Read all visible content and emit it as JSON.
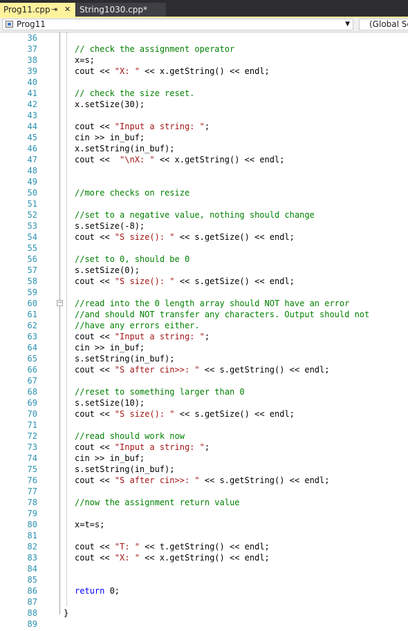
{
  "tabs": [
    {
      "label": "Prog11.cpp",
      "pin_glyph": "⇥",
      "close_glyph": "✕",
      "active": true
    },
    {
      "label": "String1030.cpp*",
      "active": false
    }
  ],
  "navbar": {
    "project": "Prog11",
    "scope": "(Global Sco"
  },
  "editor": {
    "lines": [
      {
        "n": "36",
        "code": ""
      },
      {
        "n": "37",
        "code": "// check the assignment operator"
      },
      {
        "n": "38",
        "code": "x=s;"
      },
      {
        "n": "39",
        "code": "cout << \"X: \" << x.getString() << endl;"
      },
      {
        "n": "40",
        "code": ""
      },
      {
        "n": "41",
        "code": "// check the size reset."
      },
      {
        "n": "42",
        "code": "x.setSize(30);"
      },
      {
        "n": "43",
        "code": ""
      },
      {
        "n": "44",
        "code": "cout << \"Input a string: \";"
      },
      {
        "n": "45",
        "code": "cin >> in_buf;"
      },
      {
        "n": "46",
        "code": "x.setString(in_buf);"
      },
      {
        "n": "47",
        "code": "cout <<  \"\\nX: \" << x.getString() << endl;"
      },
      {
        "n": "48",
        "code": ""
      },
      {
        "n": "49",
        "code": ""
      },
      {
        "n": "50",
        "code": "//more checks on resize"
      },
      {
        "n": "51",
        "code": ""
      },
      {
        "n": "52",
        "code": "//set to a negative value, nothing should change"
      },
      {
        "n": "53",
        "code": "s.setSize(-8);"
      },
      {
        "n": "54",
        "code": "cout << \"S size(): \" << s.getSize() << endl;"
      },
      {
        "n": "55",
        "code": ""
      },
      {
        "n": "56",
        "code": "//set to 0, should be 0"
      },
      {
        "n": "57",
        "code": "s.setSize(0);"
      },
      {
        "n": "58",
        "code": "cout << \"S size(): \" << s.getSize() << endl;"
      },
      {
        "n": "59",
        "code": ""
      },
      {
        "n": "60",
        "code": "//read into the 0 length array should NOT have an error"
      },
      {
        "n": "61",
        "code": "//and should NOT transfer any characters. Output should not"
      },
      {
        "n": "62",
        "code": "//have any errors either."
      },
      {
        "n": "63",
        "code": "cout << \"Input a string: \";"
      },
      {
        "n": "64",
        "code": "cin >> in_buf;"
      },
      {
        "n": "65",
        "code": "s.setString(in_buf);"
      },
      {
        "n": "66",
        "code": "cout << \"S after cin>>: \" << s.getString() << endl;"
      },
      {
        "n": "67",
        "code": ""
      },
      {
        "n": "68",
        "code": "//reset to something larger than 0"
      },
      {
        "n": "69",
        "code": "s.setSize(10);"
      },
      {
        "n": "70",
        "code": "cout << \"S size(): \" << s.getSize() << endl;"
      },
      {
        "n": "71",
        "code": ""
      },
      {
        "n": "72",
        "code": "//read should work now"
      },
      {
        "n": "73",
        "code": "cout << \"Input a string: \";"
      },
      {
        "n": "74",
        "code": "cin >> in_buf;"
      },
      {
        "n": "75",
        "code": "s.setString(in_buf);"
      },
      {
        "n": "76",
        "code": "cout << \"S after cin>>: \" << s.getString() << endl;"
      },
      {
        "n": "77",
        "code": ""
      },
      {
        "n": "78",
        "code": "//now the assignment return value"
      },
      {
        "n": "79",
        "code": ""
      },
      {
        "n": "80",
        "code": "x=t=s;"
      },
      {
        "n": "81",
        "code": ""
      },
      {
        "n": "82",
        "code": "cout << \"T: \" << t.getString() << endl;"
      },
      {
        "n": "83",
        "code": "cout << \"X: \" << x.getString() << endl;"
      },
      {
        "n": "84",
        "code": ""
      },
      {
        "n": "85",
        "code": ""
      },
      {
        "n": "86",
        "code": "return 0;"
      },
      {
        "n": "87",
        "code": ""
      },
      {
        "n": "88",
        "code": ""
      },
      {
        "n": "89",
        "code": ""
      }
    ],
    "closing_brace": "}",
    "collapse_glyph": "−"
  },
  "colors": {
    "line_number": "#2b91af",
    "comment": "#008000",
    "string": "#a31515",
    "keyword": "#0000ff",
    "active_tab": "#fff29d",
    "tab_bar": "#2d2d30"
  },
  "icons": [
    "project-icon",
    "pin-icon",
    "close-icon",
    "dropdown-arrow-icon",
    "collapse-icon"
  ]
}
